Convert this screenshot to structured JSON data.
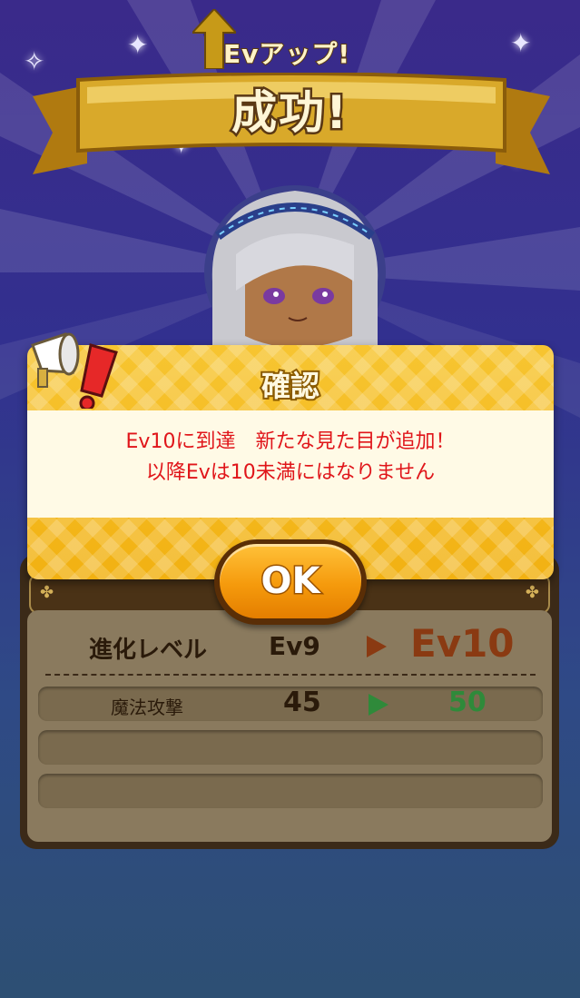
{
  "banner": {
    "ev_up_label": "Evアップ!",
    "result_label": "成功!"
  },
  "dialog": {
    "title": "確認",
    "message_line1": "Ev10に到達　新たな見た目が追加！",
    "message_line2": "以降Evは10未満にはなりません",
    "ok_label": "OK"
  },
  "status": {
    "level_label": "進化レベル",
    "level_from": "Ev9",
    "level_to": "Ev10",
    "stat_label": "魔法攻撃",
    "stat_from": "45",
    "stat_to": "50"
  },
  "colors": {
    "dialog_gold": "#f2b112",
    "message_red": "#e0151a",
    "level_up_brown": "#8a3a12",
    "stat_up_green": "#2f8a3a",
    "button_orange": "#f59a0c"
  },
  "icons": {
    "banner_arrow": "up-arrow-icon",
    "dialog_badge": "megaphone-alert-icon",
    "level_arrow": "play-arrow-icon",
    "stat_arrow": "play-arrow-icon"
  }
}
